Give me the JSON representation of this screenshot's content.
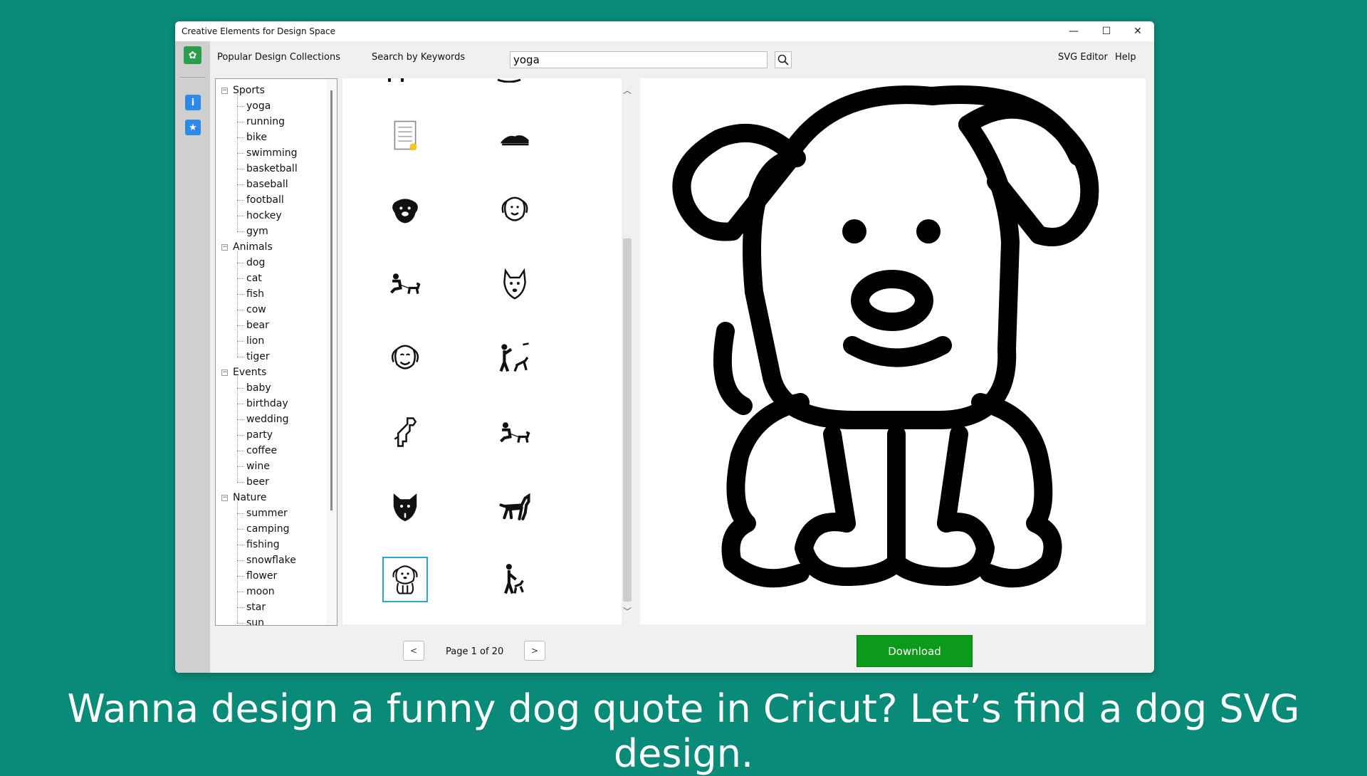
{
  "window": {
    "title": "Creative Elements for Design Space",
    "minimize": "—",
    "maximize": "☐",
    "close": "✕"
  },
  "toolbar": {
    "collections_label": "Popular Design Collections",
    "search_label": "Search by Keywords",
    "search_value": "yoga",
    "svg_editor": "SVG Editor",
    "help": "Help"
  },
  "tree": {
    "categories": [
      {
        "label": "Sports",
        "items": [
          "yoga",
          "running",
          "bike",
          "swimming",
          "basketball",
          "baseball",
          "football",
          "hockey",
          "gym"
        ]
      },
      {
        "label": "Animals",
        "items": [
          "dog",
          "cat",
          "fish",
          "cow",
          "bear",
          "lion",
          "tiger"
        ]
      },
      {
        "label": "Events",
        "items": [
          "baby",
          "birthday",
          "wedding",
          "party",
          "coffee",
          "wine",
          "beer"
        ]
      },
      {
        "label": "Nature",
        "items": [
          "summer",
          "camping",
          "fishing",
          "snowflake",
          "flower",
          "moon",
          "star",
          "sun"
        ]
      }
    ]
  },
  "thumbnails": [
    "certificate-icon",
    "sleeping-dog-icon",
    "dog-face-solid-icon",
    "dog-face-outline-icon",
    "person-with-dog-icon",
    "dog-head-outline-icon",
    "smiling-dog-outline-icon",
    "person-throwing-frisbee-dog-icon",
    "dog-outline-sitting-icon",
    "person-with-dog-icon-2",
    "dog-head-solid-icon",
    "standing-dog-icon",
    "sitting-dog-outline-icon",
    "person-walking-dog-icon"
  ],
  "selected_thumbnail": 12,
  "pager": {
    "prev": "<",
    "next": ">",
    "page_text": "Page 1 of 20"
  },
  "download_label": "Download",
  "caption": "Wanna design a funny dog quote in Cricut? Let’s find a dog SVG design.",
  "colors": {
    "background": "#0a8a78",
    "download": "#0b9a1a",
    "selection": "#2aa8c8"
  }
}
